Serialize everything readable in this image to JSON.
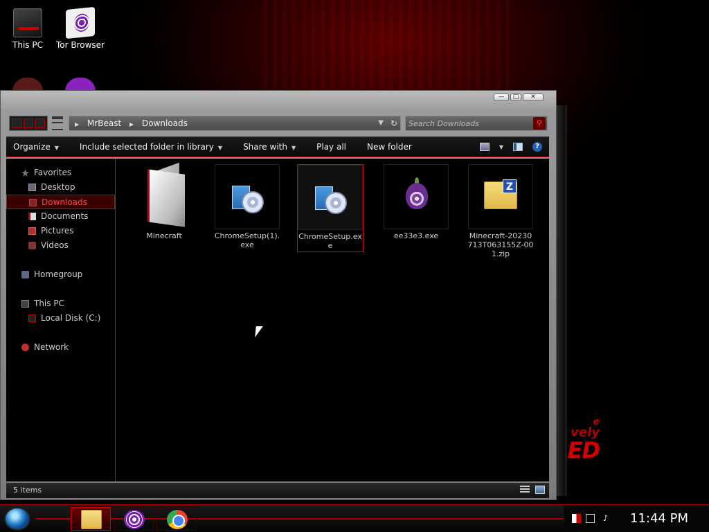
{
  "desktop": {
    "icons": [
      {
        "label": "This PC",
        "icon": "computer-icon"
      },
      {
        "label": "Tor Browser",
        "icon": "tor-browser-icon"
      }
    ]
  },
  "window": {
    "controls": {
      "minimize": "—",
      "maximize": "□",
      "close": "✕"
    },
    "address": {
      "breadcrumb": [
        "MrBeast",
        "Downloads"
      ]
    },
    "search": {
      "placeholder": "Search Downloads"
    },
    "toolbar": {
      "organize": "Organize",
      "include_library": "Include selected folder in library",
      "share_with": "Share with",
      "play_all": "Play all",
      "new_folder": "New folder",
      "help": "?"
    },
    "nav": {
      "favorites": "Favorites",
      "desktop": "Desktop",
      "downloads": "Downloads",
      "documents": "Documents",
      "pictures": "Pictures",
      "videos": "Videos",
      "homegroup": "Homegroup",
      "this_pc": "This PC",
      "local_disk": "Local Disk (C:)",
      "network": "Network"
    },
    "files": [
      {
        "name": "Minecraft",
        "type": "folder"
      },
      {
        "name": "ChromeSetup(1).exe",
        "type": "setup"
      },
      {
        "name": "ChromeSetup.exe",
        "type": "setup",
        "selected": true
      },
      {
        "name": "ee33e3.exe",
        "type": "tor"
      },
      {
        "name": "Minecraft-20230713T063155Z-001.zip",
        "type": "zip"
      }
    ],
    "status": {
      "item_count": "5 items"
    }
  },
  "taskbar": {
    "clock": "11:44 PM",
    "pinned": [
      "file-explorer-icon",
      "tor-browser-icon",
      "chrome-icon"
    ]
  },
  "wallpaper": {
    "text_lines": [
      "e",
      "vely",
      "ED"
    ]
  },
  "colors": {
    "accent": "#cc0000",
    "selection": "#ff4040"
  }
}
